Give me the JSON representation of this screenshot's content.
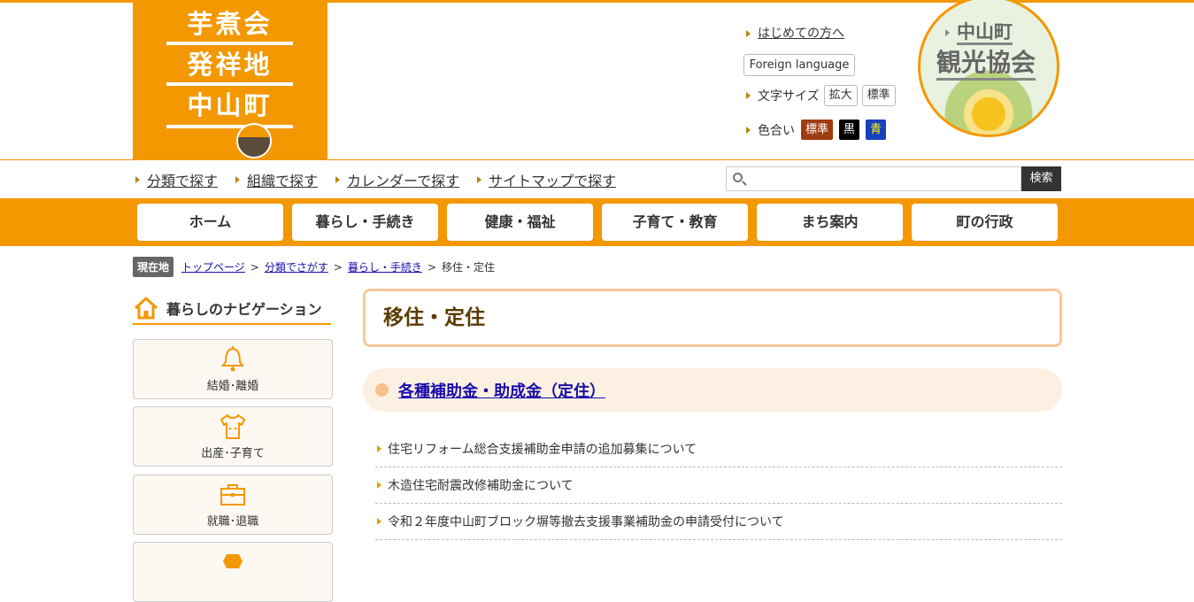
{
  "logo": {
    "lines": [
      "芋煮会",
      "発祥地",
      "中山町"
    ]
  },
  "header": {
    "first_visit": "はじめての方へ",
    "foreign": "Foreign language",
    "font_size_label": "文字サイズ",
    "font_size_buttons": [
      "拡大",
      "標準"
    ],
    "color_label": "色合い",
    "color_buttons": [
      {
        "label": "標準",
        "bg": "#a03c10",
        "fg": "#ffffff"
      },
      {
        "label": "黒",
        "bg": "#000000",
        "fg": "#ffffff"
      },
      {
        "label": "青",
        "bg": "#1a3fbf",
        "fg": "#ffff00"
      }
    ],
    "tourism": {
      "line1": "中山町",
      "line2": "観光協会"
    }
  },
  "subnav": [
    "分類で探す",
    "組織で探す",
    "カレンダーで探す",
    "サイトマップで探す"
  ],
  "search": {
    "placeholder": "",
    "button": "検索"
  },
  "global_nav": [
    "ホーム",
    "暮らし・手続き",
    "健康・福祉",
    "子育て・教育",
    "まち案内",
    "町の行政"
  ],
  "breadcrumb": {
    "here": "現在地",
    "links": [
      "トップページ",
      "分類でさがす",
      "暮らし・手続き"
    ],
    "current": "移住・定住"
  },
  "sidebar": {
    "title": "暮らしのナビゲーション",
    "items": [
      {
        "label": "結婚･離婚",
        "icon": "bell-icon"
      },
      {
        "label": "出産･子育て",
        "icon": "baby-clothes-icon"
      },
      {
        "label": "就職･退職",
        "icon": "briefcase-icon"
      }
    ]
  },
  "main": {
    "title": "移住・定住",
    "section_title": "各種補助金・助成金（定住）",
    "links": [
      "住宅リフォーム総合支援補助金申請の追加募集について",
      "木造住宅耐震改修補助金について",
      "令和２年度中山町ブロック塀等撤去支援事業補助金の申請受付について"
    ]
  },
  "colors": {
    "accent": "#f39800",
    "title_border": "#f8c89a",
    "section_bg": "#fcf0e2"
  }
}
